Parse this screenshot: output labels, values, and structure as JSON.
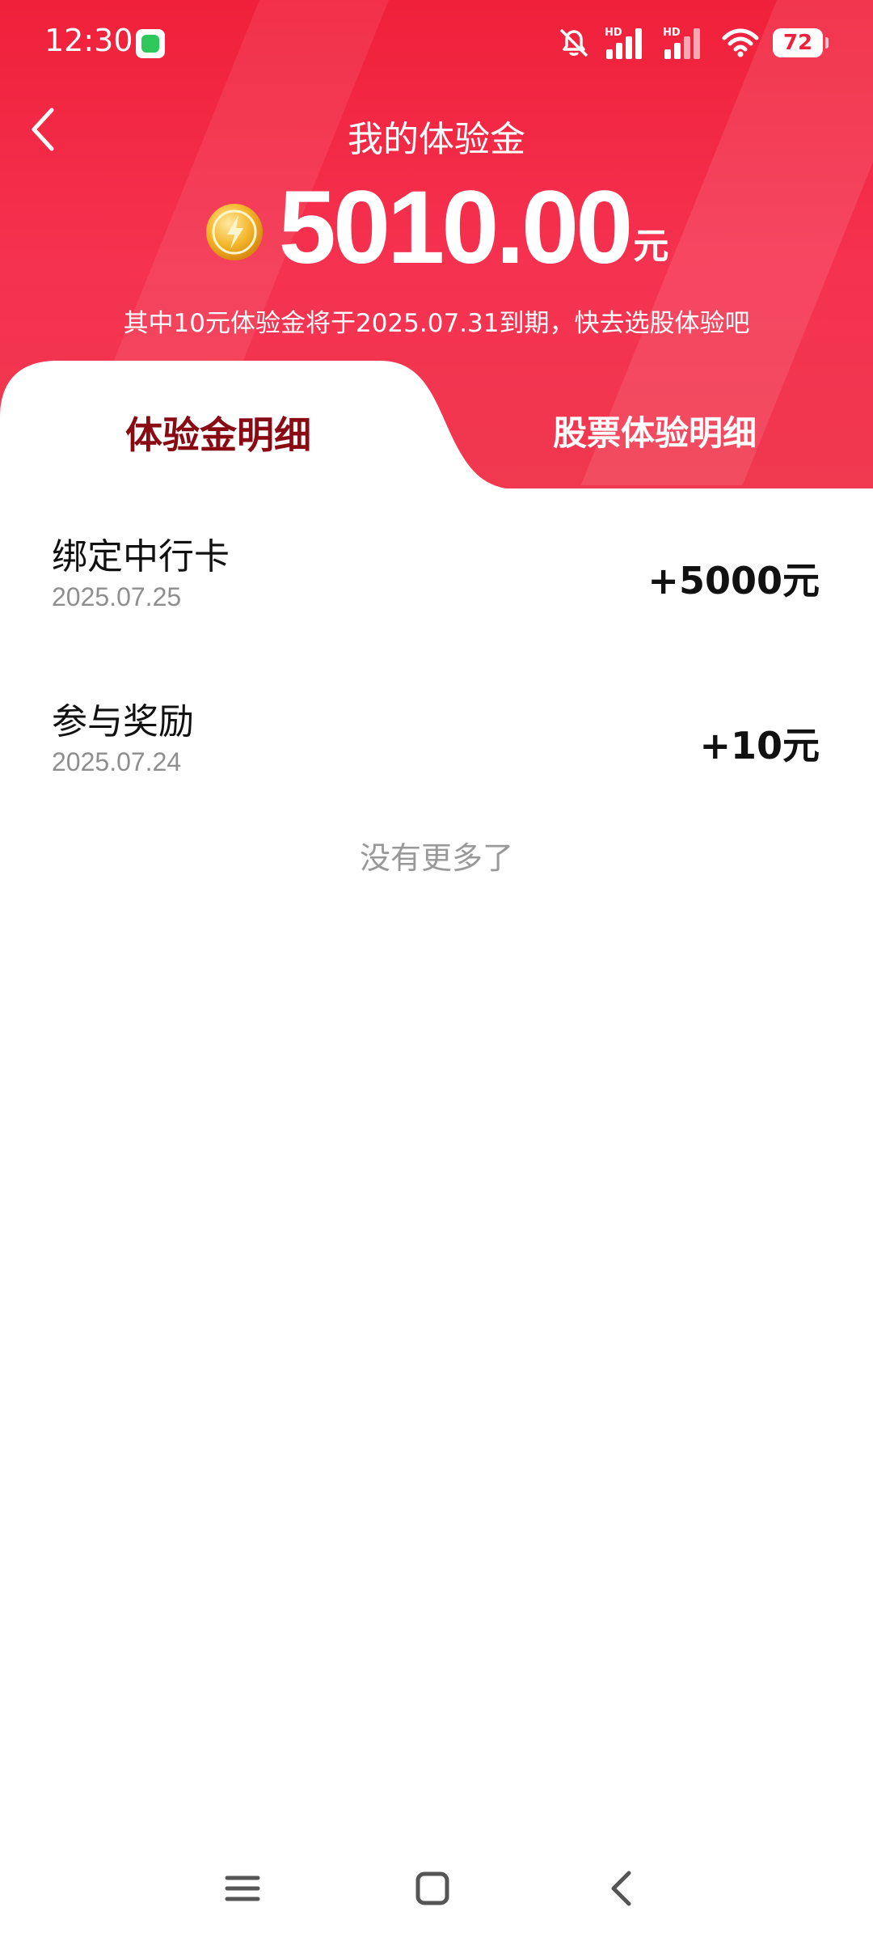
{
  "status_bar": {
    "time": "12:30",
    "hd_label": "HD",
    "battery": "72",
    "icons": [
      "message-app-icon",
      "mute-bell-icon",
      "signal-icon",
      "signal-icon",
      "wifi-icon",
      "battery-icon"
    ]
  },
  "header": {
    "title": "我的体验金",
    "amount": "5010.00",
    "unit": "元",
    "notice": "其中10元体验金将于2025.07.31到期，快去选股体验吧"
  },
  "tabs": [
    {
      "label": "体验金明细",
      "active": true
    },
    {
      "label": "股票体验明细",
      "active": false
    }
  ],
  "records": [
    {
      "title": "绑定中行卡",
      "date": "2025.07.25",
      "amount": "+5000元"
    },
    {
      "title": "参与奖励",
      "date": "2025.07.24",
      "amount": "+10元"
    }
  ],
  "footer_text": "没有更多了",
  "colors": {
    "brand_red": "#f0203a",
    "active_tab_text": "#8a0a14"
  }
}
